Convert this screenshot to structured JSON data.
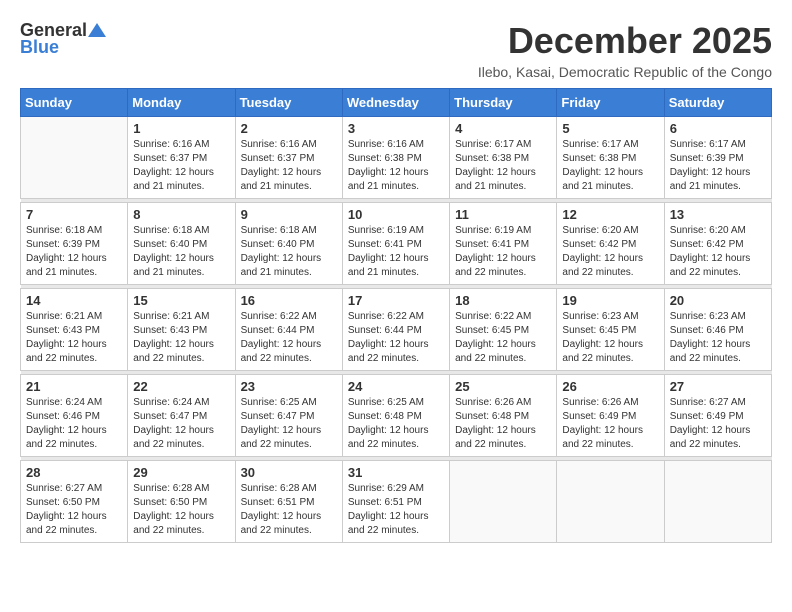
{
  "logo": {
    "general": "General",
    "blue": "Blue"
  },
  "title": "December 2025",
  "location": "Ilebo, Kasai, Democratic Republic of the Congo",
  "headers": [
    "Sunday",
    "Monday",
    "Tuesday",
    "Wednesday",
    "Thursday",
    "Friday",
    "Saturday"
  ],
  "weeks": [
    [
      {
        "day": "",
        "sunrise": "",
        "sunset": "",
        "daylight": ""
      },
      {
        "day": "1",
        "sunrise": "Sunrise: 6:16 AM",
        "sunset": "Sunset: 6:37 PM",
        "daylight": "Daylight: 12 hours and 21 minutes."
      },
      {
        "day": "2",
        "sunrise": "Sunrise: 6:16 AM",
        "sunset": "Sunset: 6:37 PM",
        "daylight": "Daylight: 12 hours and 21 minutes."
      },
      {
        "day": "3",
        "sunrise": "Sunrise: 6:16 AM",
        "sunset": "Sunset: 6:38 PM",
        "daylight": "Daylight: 12 hours and 21 minutes."
      },
      {
        "day": "4",
        "sunrise": "Sunrise: 6:17 AM",
        "sunset": "Sunset: 6:38 PM",
        "daylight": "Daylight: 12 hours and 21 minutes."
      },
      {
        "day": "5",
        "sunrise": "Sunrise: 6:17 AM",
        "sunset": "Sunset: 6:38 PM",
        "daylight": "Daylight: 12 hours and 21 minutes."
      },
      {
        "day": "6",
        "sunrise": "Sunrise: 6:17 AM",
        "sunset": "Sunset: 6:39 PM",
        "daylight": "Daylight: 12 hours and 21 minutes."
      }
    ],
    [
      {
        "day": "7",
        "sunrise": "Sunrise: 6:18 AM",
        "sunset": "Sunset: 6:39 PM",
        "daylight": "Daylight: 12 hours and 21 minutes."
      },
      {
        "day": "8",
        "sunrise": "Sunrise: 6:18 AM",
        "sunset": "Sunset: 6:40 PM",
        "daylight": "Daylight: 12 hours and 21 minutes."
      },
      {
        "day": "9",
        "sunrise": "Sunrise: 6:18 AM",
        "sunset": "Sunset: 6:40 PM",
        "daylight": "Daylight: 12 hours and 21 minutes."
      },
      {
        "day": "10",
        "sunrise": "Sunrise: 6:19 AM",
        "sunset": "Sunset: 6:41 PM",
        "daylight": "Daylight: 12 hours and 21 minutes."
      },
      {
        "day": "11",
        "sunrise": "Sunrise: 6:19 AM",
        "sunset": "Sunset: 6:41 PM",
        "daylight": "Daylight: 12 hours and 22 minutes."
      },
      {
        "day": "12",
        "sunrise": "Sunrise: 6:20 AM",
        "sunset": "Sunset: 6:42 PM",
        "daylight": "Daylight: 12 hours and 22 minutes."
      },
      {
        "day": "13",
        "sunrise": "Sunrise: 6:20 AM",
        "sunset": "Sunset: 6:42 PM",
        "daylight": "Daylight: 12 hours and 22 minutes."
      }
    ],
    [
      {
        "day": "14",
        "sunrise": "Sunrise: 6:21 AM",
        "sunset": "Sunset: 6:43 PM",
        "daylight": "Daylight: 12 hours and 22 minutes."
      },
      {
        "day": "15",
        "sunrise": "Sunrise: 6:21 AM",
        "sunset": "Sunset: 6:43 PM",
        "daylight": "Daylight: 12 hours and 22 minutes."
      },
      {
        "day": "16",
        "sunrise": "Sunrise: 6:22 AM",
        "sunset": "Sunset: 6:44 PM",
        "daylight": "Daylight: 12 hours and 22 minutes."
      },
      {
        "day": "17",
        "sunrise": "Sunrise: 6:22 AM",
        "sunset": "Sunset: 6:44 PM",
        "daylight": "Daylight: 12 hours and 22 minutes."
      },
      {
        "day": "18",
        "sunrise": "Sunrise: 6:22 AM",
        "sunset": "Sunset: 6:45 PM",
        "daylight": "Daylight: 12 hours and 22 minutes."
      },
      {
        "day": "19",
        "sunrise": "Sunrise: 6:23 AM",
        "sunset": "Sunset: 6:45 PM",
        "daylight": "Daylight: 12 hours and 22 minutes."
      },
      {
        "day": "20",
        "sunrise": "Sunrise: 6:23 AM",
        "sunset": "Sunset: 6:46 PM",
        "daylight": "Daylight: 12 hours and 22 minutes."
      }
    ],
    [
      {
        "day": "21",
        "sunrise": "Sunrise: 6:24 AM",
        "sunset": "Sunset: 6:46 PM",
        "daylight": "Daylight: 12 hours and 22 minutes."
      },
      {
        "day": "22",
        "sunrise": "Sunrise: 6:24 AM",
        "sunset": "Sunset: 6:47 PM",
        "daylight": "Daylight: 12 hours and 22 minutes."
      },
      {
        "day": "23",
        "sunrise": "Sunrise: 6:25 AM",
        "sunset": "Sunset: 6:47 PM",
        "daylight": "Daylight: 12 hours and 22 minutes."
      },
      {
        "day": "24",
        "sunrise": "Sunrise: 6:25 AM",
        "sunset": "Sunset: 6:48 PM",
        "daylight": "Daylight: 12 hours and 22 minutes."
      },
      {
        "day": "25",
        "sunrise": "Sunrise: 6:26 AM",
        "sunset": "Sunset: 6:48 PM",
        "daylight": "Daylight: 12 hours and 22 minutes."
      },
      {
        "day": "26",
        "sunrise": "Sunrise: 6:26 AM",
        "sunset": "Sunset: 6:49 PM",
        "daylight": "Daylight: 12 hours and 22 minutes."
      },
      {
        "day": "27",
        "sunrise": "Sunrise: 6:27 AM",
        "sunset": "Sunset: 6:49 PM",
        "daylight": "Daylight: 12 hours and 22 minutes."
      }
    ],
    [
      {
        "day": "28",
        "sunrise": "Sunrise: 6:27 AM",
        "sunset": "Sunset: 6:50 PM",
        "daylight": "Daylight: 12 hours and 22 minutes."
      },
      {
        "day": "29",
        "sunrise": "Sunrise: 6:28 AM",
        "sunset": "Sunset: 6:50 PM",
        "daylight": "Daylight: 12 hours and 22 minutes."
      },
      {
        "day": "30",
        "sunrise": "Sunrise: 6:28 AM",
        "sunset": "Sunset: 6:51 PM",
        "daylight": "Daylight: 12 hours and 22 minutes."
      },
      {
        "day": "31",
        "sunrise": "Sunrise: 6:29 AM",
        "sunset": "Sunset: 6:51 PM",
        "daylight": "Daylight: 12 hours and 22 minutes."
      },
      {
        "day": "",
        "sunrise": "",
        "sunset": "",
        "daylight": ""
      },
      {
        "day": "",
        "sunrise": "",
        "sunset": "",
        "daylight": ""
      },
      {
        "day": "",
        "sunrise": "",
        "sunset": "",
        "daylight": ""
      }
    ]
  ]
}
